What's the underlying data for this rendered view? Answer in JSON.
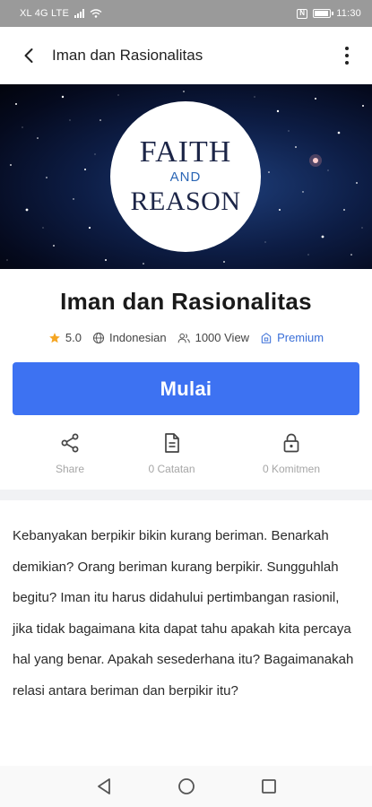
{
  "status_bar": {
    "carrier": "XL 4G LTE",
    "time": "11:30",
    "nfc": "N"
  },
  "app_bar": {
    "title": "Iman dan Rasionalitas"
  },
  "cover": {
    "line1": "FAITH",
    "line2": "AND",
    "line3": "REASON"
  },
  "book": {
    "title": "Iman dan Rasionalitas",
    "rating": "5.0",
    "language": "Indonesian",
    "views": "1000 View",
    "tier": "Premium"
  },
  "start_button": {
    "label": "Mulai"
  },
  "actions": [
    {
      "label": "Share",
      "icon": "share-icon"
    },
    {
      "label": "0 Catatan",
      "icon": "document-icon"
    },
    {
      "label": "0 Komitmen",
      "icon": "lock-icon"
    }
  ],
  "description": "Kebanyakan berpikir bikin kurang beriman. Benarkah demikian? Orang beriman kurang berpikir. Sungguhlah begitu? Iman itu harus didahului pertimbangan rasionil, jika tidak bagaimana kita dapat tahu apakah kita percaya hal yang benar. Apakah sesederhana itu? Bagaimanakah relasi antara beriman dan berpikir itu?",
  "colors": {
    "accent": "#3d72f2",
    "premium": "#3a6fd8",
    "star": "#f5a623",
    "status_bar": "#9a9a9a"
  }
}
